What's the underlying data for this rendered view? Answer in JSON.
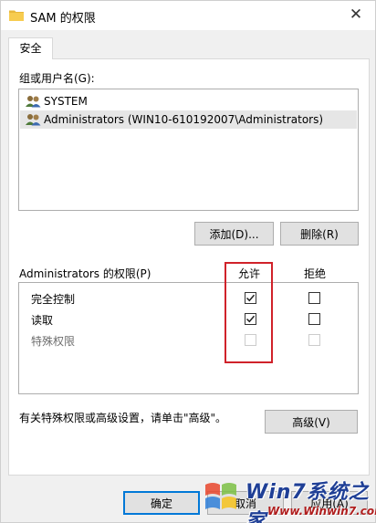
{
  "window": {
    "title": "SAM 的权限",
    "close_glyph": "✕"
  },
  "tabs": [
    {
      "label": "安全",
      "active": true
    }
  ],
  "users": {
    "label": "组或用户名(G):",
    "items": [
      {
        "name": "SYSTEM",
        "selected": false
      },
      {
        "name": "Administrators (WIN10-610192007\\Administrators)",
        "selected": true
      }
    ]
  },
  "user_buttons": {
    "add_label": "添加(D)...",
    "remove_label": "删除(R)"
  },
  "permissions": {
    "header_label": "Administrators 的权限(P)",
    "allow_label": "允许",
    "deny_label": "拒绝",
    "rows": [
      {
        "name": "完全控制",
        "allow": "checked",
        "deny": "unchecked"
      },
      {
        "name": "读取",
        "allow": "checked",
        "deny": "unchecked"
      },
      {
        "name": "特殊权限",
        "allow": "disabled",
        "deny": "disabled"
      }
    ]
  },
  "advanced": {
    "hint": "有关特殊权限或高级设置，请单击\"高级\"。",
    "button_label": "高级(V)"
  },
  "footer": {
    "ok_label": "确定",
    "cancel_label": "取消",
    "apply_label": "应用(A)"
  },
  "watermark": {
    "line1": "Win7系统之家",
    "line2": "Www.Winwin7.com"
  },
  "colors": {
    "highlight_box": "#d0222a",
    "selection": "#e6e6e6",
    "default_button_border": "#0078d7"
  }
}
